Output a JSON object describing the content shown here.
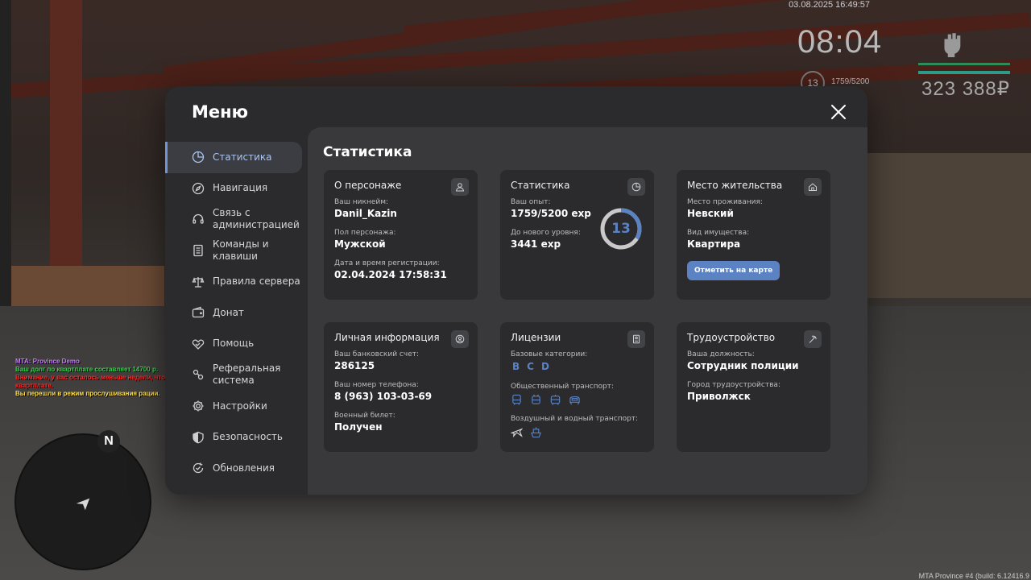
{
  "hud": {
    "date": "03.08.2025 16:49:57",
    "time": "08:04",
    "level": "13",
    "exp": "1759/5200",
    "money": "323 388₽"
  },
  "chat": [
    {
      "text": "MTA: Province Demo",
      "color": "#c77dff"
    },
    {
      "text": "Ваш долг по квартплате составляет 14700 р.",
      "color": "#39d353"
    },
    {
      "text": "Внимание, у вас осталось меньше недели, чтобы погасить задолженность по",
      "color": "#ff2a2a"
    },
    {
      "text": "квартплате.",
      "color": "#ff2a2a"
    },
    {
      "text": "Вы перешли в режим прослушивания рации.",
      "color": "#ffe14a"
    }
  ],
  "minimap": {
    "north": "N"
  },
  "build": "MTA Province #4 (build: 6.12416.9",
  "menu": {
    "title": "Меню",
    "sidebar": [
      {
        "label": "Статистика",
        "icon": "pie-chart-icon",
        "active": true
      },
      {
        "label": "Навигация",
        "icon": "compass-icon"
      },
      {
        "label": "Связь с администрацией",
        "icon": "headset-icon"
      },
      {
        "label": "Команды и клавиши",
        "icon": "keyboard-doc-icon"
      },
      {
        "label": "Правила сервера",
        "icon": "scales-icon"
      },
      {
        "label": "Донат",
        "icon": "wallet-icon"
      },
      {
        "label": "Помощь",
        "icon": "handshake-heart-icon"
      },
      {
        "label": "Реферальная система",
        "icon": "referral-icon"
      },
      {
        "label": "Настройки",
        "icon": "gear-icon"
      },
      {
        "label": "Безопасность",
        "icon": "shield-icon"
      },
      {
        "label": "Обновления",
        "icon": "refresh-check-icon"
      }
    ],
    "content_title": "Статистика",
    "cards": {
      "character": {
        "title": "О персонаже",
        "nick_label": "Ваш никнейм:",
        "nick": "Danil_Kazin",
        "gender_label": "Пол персонажа:",
        "gender": "Мужской",
        "reg_label": "Дата и время регистрации:",
        "reg": "02.04.2024 17:58:31"
      },
      "stats": {
        "title": "Статистика",
        "exp_label": "Ваш опыт:",
        "exp": "1759/5200 exp",
        "next_label": "До нового уровня:",
        "next": "3441 exp",
        "level": "13",
        "progress": 0.338
      },
      "residence": {
        "title": "Место жительства",
        "place_label": "Место проживания:",
        "place": "Невский",
        "property_label": "Вид имущества:",
        "property": "Квартира",
        "button": "Отметить на карте"
      },
      "personal": {
        "title": "Личная информация",
        "bank_label": "Ваш банковский счет:",
        "bank": "286125",
        "phone_label": "Ваш номер телефона:",
        "phone": "8 (963) 103-03-69",
        "military_label": "Военный билет:",
        "military": "Получен"
      },
      "licenses": {
        "title": "Лицензии",
        "base_label": "Базовые категории:",
        "categories": [
          "B",
          "C",
          "D"
        ],
        "public_label": "Общественный транспорт:",
        "air_label": "Воздушный и водный транспорт:"
      },
      "employment": {
        "title": "Трудоустройство",
        "position_label": "Ваша должность:",
        "position": "Сотрудник полиции",
        "city_label": "Город трудоустройства:",
        "city": "Приволжск"
      }
    }
  },
  "colors": {
    "accent": "#5b82c2",
    "panel": "#2b2b2d",
    "content": "#39393c"
  }
}
